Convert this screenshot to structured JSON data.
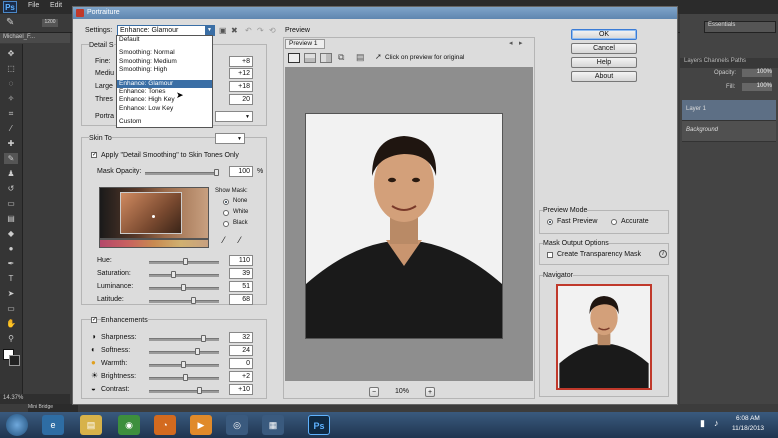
{
  "ps": {
    "logo": "Ps",
    "menu": [
      "File",
      "Edit"
    ],
    "doc_tab": "Michael_F...",
    "zoom_field": "1200",
    "status_zoom": "14.37%",
    "mini_bridge": "Mini Bridge",
    "essentials": "Essentials",
    "panel_tabs": "Layers  Channels  Paths",
    "opacity_label": "Opacity:",
    "opacity_value": "100%",
    "fill_label": "Fill:",
    "fill_value": "100%",
    "layers": [
      "Layer 1",
      "Background"
    ]
  },
  "dialog": {
    "title": "Portraiture",
    "settings_label": "Settings:",
    "settings_value": "Enhance: Glamour",
    "preset_options": [
      "Default",
      "Smoothing: Normal",
      "Smoothing: Medium",
      "Smoothing: High",
      "Enhance: Glamour",
      "Enhance: Tones",
      "Enhance: High Key",
      "Enhance: Low Key",
      "Custom"
    ],
    "selected_option": "Enhance: Glamour",
    "detail_header": "Detail S",
    "detail_rows": [
      {
        "label": "Fine:",
        "value": "+8"
      },
      {
        "label": "Mediu",
        "value": "+12"
      },
      {
        "label": "Large",
        "value": "+18"
      },
      {
        "label": "Thres",
        "value": "20"
      }
    ],
    "portrait_label": "Portra",
    "skin_header": "Skin To",
    "apply_detail_smoothing": "Apply \"Detail Smoothing\" to Skin Tones Only",
    "mask_opacity_label": "Mask Opacity:",
    "mask_opacity_value": "100",
    "mask_opacity_unit": "%",
    "show_mask_label": "Show Mask:",
    "show_mask_options": [
      "None",
      "White",
      "Black"
    ],
    "skin_rows": [
      {
        "label": "Hue:",
        "value": "110"
      },
      {
        "label": "Saturation:",
        "value": "39"
      },
      {
        "label": "Luminance:",
        "value": "51"
      },
      {
        "label": "Latitude:",
        "value": "68"
      }
    ],
    "enhancements_label": "Enhancements",
    "enh_rows": [
      {
        "label": "Sharpness:",
        "value": "32"
      },
      {
        "label": "Softness:",
        "value": "24"
      },
      {
        "label": "Warmth:",
        "value": "0"
      },
      {
        "label": "Brightness:",
        "value": "+2"
      },
      {
        "label": "Contrast:",
        "value": "+10"
      }
    ],
    "preview_label": "Preview",
    "preview_tab": "Preview 1",
    "preview_hint": "Click on preview for original",
    "zoom_value": "10%",
    "zoom_minus": "−",
    "zoom_plus": "+",
    "buttons": {
      "ok": "OK",
      "cancel": "Cancel",
      "help": "Help",
      "about": "About"
    },
    "preview_mode_label": "Preview Mode",
    "fast_preview": "Fast Preview",
    "accurate": "Accurate",
    "mask_output_label": "Mask Output Options",
    "create_mask": "Create Transparency Mask",
    "info_glyph": "i",
    "navigator_label": "Navigator"
  },
  "taskbar": {
    "time": "6:08 AM",
    "date": "11/18/2013",
    "ps_icon": "Ps"
  },
  "colors": {
    "accent": "#3a6ea5",
    "ps_dark": "#2b2b2b",
    "dialog_bg": "#dcdcdc",
    "navigator_frame": "#c0392b"
  }
}
